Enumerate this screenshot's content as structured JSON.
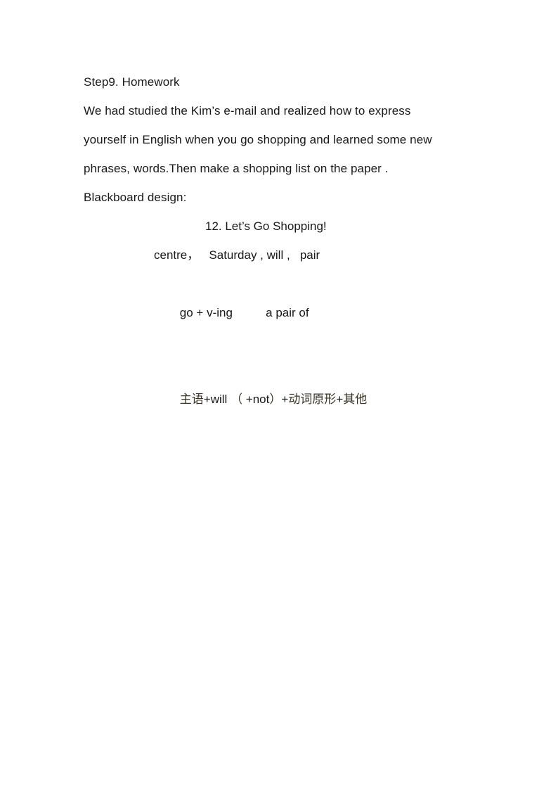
{
  "document": {
    "page_background": "#ffffff",
    "text_color": "#181818",
    "cjk_color": "#3a3428",
    "section_heading": "Step9. Homework",
    "paragraph": {
      "line_1": "We had studied the Kim’s e-mail and realized how to express",
      "line_2": "yourself in English when you go shopping and learned some new",
      "line_3": "phrases, words.Then make a shopping list on the paper ."
    },
    "blackboard_label": "Blackboard design:",
    "blackboard": {
      "title": "12. Let’s Go Shopping!",
      "vocabulary_row": "centre，   Saturday , will ,   pair",
      "phrase_row": {
        "left": "go + v-ing",
        "right": "a pair of"
      },
      "grammar_row": {
        "cjk_subject": "主语",
        "latin_will": "+will",
        "paren_open": "（",
        "latin_not": " +not",
        "paren_close": "）",
        "latin_plus": "+",
        "cjk_verb": "动词原形",
        "latin_plus_2": "+",
        "cjk_other": "其他",
        "full_text": "主语+will （ +not）+动词原形+其他"
      }
    }
  }
}
